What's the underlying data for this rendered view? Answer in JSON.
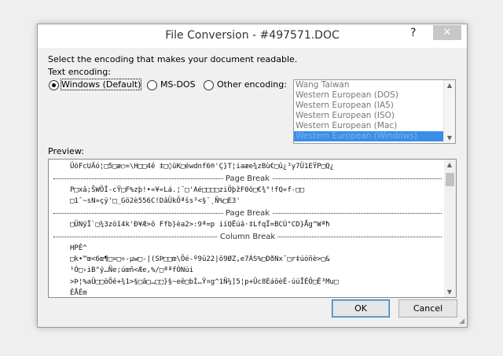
{
  "title": "File Conversion - #497571.DOC",
  "title_buttons": {
    "help": "?",
    "close": "✕"
  },
  "instruction": "Select the encoding that makes your document readable.",
  "text_encoding_label": "Text encoding:",
  "radio_options": [
    {
      "label": "Windows (Default)",
      "selected": true
    },
    {
      "label": "MS-DOS",
      "selected": false
    },
    {
      "label": "Other encoding:",
      "selected": false
    }
  ],
  "encodings": [
    {
      "label": "Wang Taiwan",
      "selected": false
    },
    {
      "label": "Western European (DOS)",
      "selected": false
    },
    {
      "label": "Western European (IA5)",
      "selected": false
    },
    {
      "label": "Western European (ISO)",
      "selected": false
    },
    {
      "label": "Western European (Mac)",
      "selected": false
    },
    {
      "label": "Western European (Windows)",
      "selected": true
    }
  ],
  "preview_label": "Preview:",
  "preview_lines": [
    "ÜöFcUÄó¦□5□æ○=\\H□□4ê ‡□◊ûK□éwdnf6®'Ç}T¦iaæe¾zBù€□û¿³y7Ü1EŸP□Q¿",
    "P□xâ;ŠWÕÎ-cŸ□F%zþ!•«¥«Lá.¦¨□'Aé□□□□ziÖþžF0ö□€¾°!fQ«f-□□",
    "□1¯~sN»çÿ'□_Gö2è556C!DâÜkÕªšs³<§¯¸Ñ%□E3'",
    "□ÜNýÏ`□¾3zöî4k'Ð¥Æ>ô Ffb}èa2>:9ª=p iíQËúâ·‡LfqÏ=BCÚ°CD}Åg^Wªħ",
    "HPÊ^",
    " □k•™œ<6œ¶□¤□÷-µw□-|(SÞ□□œ\\Õé-º9ü22|ô9ØZ,e7ÁS%□DðNx¯□r‡úóñè>□&",
    "¹Ó□›iB\"ý…Ñe;úœñ<Æe,%/□ªªfÓNúi",
    ">Þ¦%aÜ□□öÕê+¾1>§□â□…□□}§~eê□bÌ…Ÿ¤g^1Ñ¼]5¦p+Ûc8ÈáôèÊ-úúÏÊÕ□Ë³Mu□",
    "ÊÅÊm"
  ],
  "breaks": [
    "Page Break",
    "Page Break",
    "Column Break"
  ],
  "buttons": {
    "ok": "OK",
    "cancel": "Cancel"
  }
}
